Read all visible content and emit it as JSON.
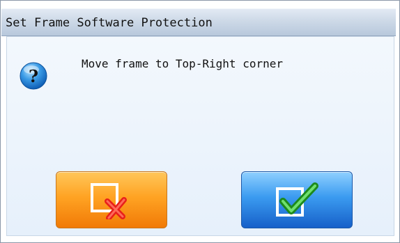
{
  "dialog": {
    "title": "Set Frame Software Protection",
    "message": "Move frame to Top-Right corner",
    "icon": "question-icon",
    "buttons": {
      "cancel_icon": "cancel-x-icon",
      "confirm_icon": "confirm-check-icon"
    }
  },
  "colors": {
    "cancel": "#f59a1c",
    "confirm": "#2f86e8",
    "title_bar": "#c8d5e5"
  }
}
